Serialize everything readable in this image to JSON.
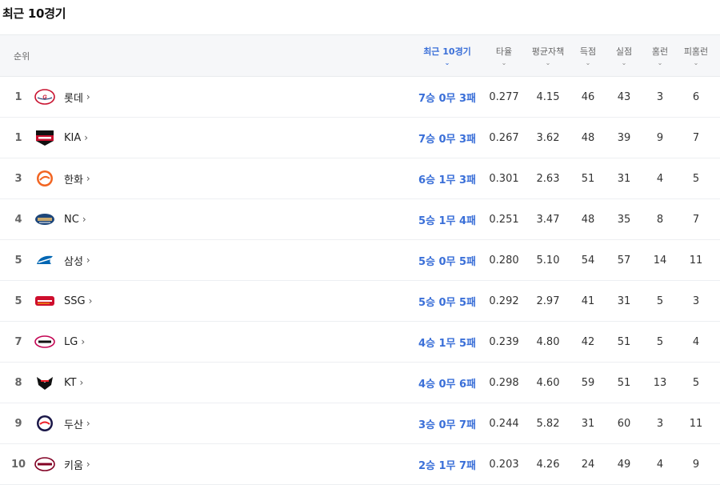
{
  "page_title": "최근 10경기",
  "headers": {
    "rank": "순위",
    "recent": "최근 10경기",
    "avg": "타율",
    "era": "평균자책",
    "runs": "득점",
    "runs_allowed": "실점",
    "hr": "홈런",
    "hr_allowed": "피홈런"
  },
  "chevron": "⌄",
  "team_chevron": "›",
  "colors": {
    "accent": "#3a6fd8",
    "header_bg": "#f6f7f9"
  },
  "rows": [
    {
      "rank": "1",
      "team": "롯데",
      "logo": "giants-logo",
      "recent": "7승 0무 3패",
      "avg": "0.277",
      "era": "4.15",
      "runs": "46",
      "runs_allowed": "43",
      "hr": "3",
      "hr_allowed": "6"
    },
    {
      "rank": "1",
      "team": "KIA",
      "logo": "tigers-logo",
      "recent": "7승 0무 3패",
      "avg": "0.267",
      "era": "3.62",
      "runs": "48",
      "runs_allowed": "39",
      "hr": "9",
      "hr_allowed": "7"
    },
    {
      "rank": "3",
      "team": "한화",
      "logo": "eagles-logo",
      "recent": "6승 1무 3패",
      "avg": "0.301",
      "era": "2.63",
      "runs": "51",
      "runs_allowed": "31",
      "hr": "4",
      "hr_allowed": "5"
    },
    {
      "rank": "4",
      "team": "NC",
      "logo": "dinos-logo",
      "recent": "5승 1무 4패",
      "avg": "0.251",
      "era": "3.47",
      "runs": "48",
      "runs_allowed": "35",
      "hr": "8",
      "hr_allowed": "7"
    },
    {
      "rank": "5",
      "team": "삼성",
      "logo": "lions-logo",
      "recent": "5승 0무 5패",
      "avg": "0.280",
      "era": "5.10",
      "runs": "54",
      "runs_allowed": "57",
      "hr": "14",
      "hr_allowed": "11"
    },
    {
      "rank": "5",
      "team": "SSG",
      "logo": "landers-logo",
      "recent": "5승 0무 5패",
      "avg": "0.292",
      "era": "2.97",
      "runs": "41",
      "runs_allowed": "31",
      "hr": "5",
      "hr_allowed": "3"
    },
    {
      "rank": "7",
      "team": "LG",
      "logo": "twins-logo",
      "recent": "4승 1무 5패",
      "avg": "0.239",
      "era": "4.80",
      "runs": "42",
      "runs_allowed": "51",
      "hr": "5",
      "hr_allowed": "4"
    },
    {
      "rank": "8",
      "team": "KT",
      "logo": "kt-wiz-logo",
      "recent": "4승 0무 6패",
      "avg": "0.298",
      "era": "4.60",
      "runs": "59",
      "runs_allowed": "51",
      "hr": "13",
      "hr_allowed": "5"
    },
    {
      "rank": "9",
      "team": "두산",
      "logo": "bears-logo",
      "recent": "3승 0무 7패",
      "avg": "0.244",
      "era": "5.82",
      "runs": "31",
      "runs_allowed": "60",
      "hr": "3",
      "hr_allowed": "11"
    },
    {
      "rank": "10",
      "team": "키움",
      "logo": "heroes-logo",
      "recent": "2승 1무 7패",
      "avg": "0.203",
      "era": "4.26",
      "runs": "24",
      "runs_allowed": "49",
      "hr": "4",
      "hr_allowed": "9"
    }
  ]
}
